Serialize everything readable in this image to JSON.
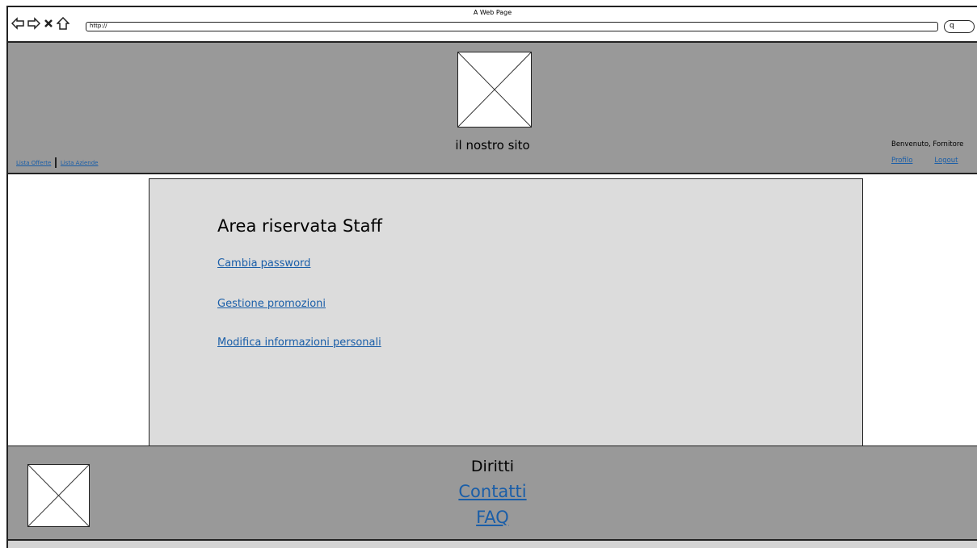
{
  "window": {
    "title": "A Web Page",
    "url": "http://"
  },
  "header": {
    "site_name": "il nostro sito",
    "nav_links": [
      "Lista Offerte",
      "Lista Aziende"
    ],
    "welcome": "Benvenuto, Fornitore",
    "user_links": [
      "Profilo",
      "Logout"
    ]
  },
  "main": {
    "title": "Area riservata Staff",
    "links": [
      "Cambia password",
      "Gestione promozioni",
      "Modifica informazioni personali"
    ]
  },
  "footer": {
    "rights": "Diritti",
    "links": [
      "Contatti",
      "FAQ"
    ]
  },
  "colors": {
    "link": "#1a5ea8",
    "header_bg": "#999999",
    "panel_bg": "#dcdcdc"
  }
}
